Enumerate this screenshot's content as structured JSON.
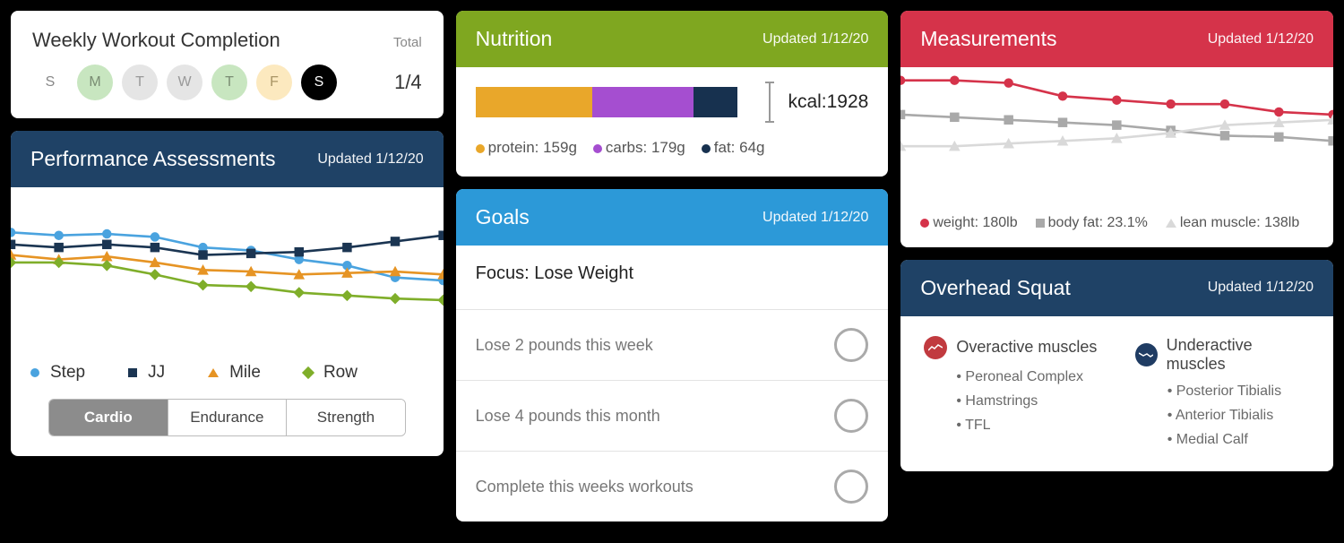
{
  "weekly": {
    "title": "Weekly Workout Completion",
    "total_label": "Total",
    "days": [
      "S",
      "M",
      "T",
      "W",
      "T",
      "F",
      "S"
    ],
    "day_styles": [
      "plain",
      "green",
      "grey",
      "grey",
      "green",
      "yellow",
      "black"
    ],
    "count": "1/4"
  },
  "performance": {
    "title": "Performance Assessments",
    "updated": "Updated 1/12/20",
    "legend": {
      "step": "Step",
      "jj": "JJ",
      "mile": "Mile",
      "row": "Row"
    },
    "tabs": [
      "Cardio",
      "Endurance",
      "Strength"
    ],
    "active_tab": 0,
    "colors": {
      "step": "#4aa3df",
      "jj": "#1b3552",
      "mile": "#e69424",
      "row": "#7fae2a"
    }
  },
  "nutrition": {
    "title": "Nutrition",
    "updated": "Updated 1/12/20",
    "kcal_label": "kcal:1928",
    "protein_label": "protein: 159g",
    "carbs_label": "carbs: 179g",
    "fat_label": "fat: 64g",
    "colors": {
      "protein": "#e9a72a",
      "carbs": "#a54ed0",
      "fat": "#17314f"
    },
    "segments_pct": {
      "protein": 40,
      "carbs": 35,
      "fat": 15
    }
  },
  "goals": {
    "title": "Goals",
    "updated": "Updated 1/12/20",
    "focus": "Focus: Lose Weight",
    "items": [
      "Lose 2 pounds this week",
      "Lose 4 pounds this month",
      "Complete this weeks workouts"
    ]
  },
  "measurements": {
    "title": "Measurements",
    "updated": "Updated 1/12/20",
    "weight_label": "weight: 180lb",
    "bodyfat_label": "body fat: 23.1%",
    "lean_label": "lean muscle: 138lb",
    "colors": {
      "weight": "#d5334a",
      "bodyfat": "#a9a9a9",
      "lean": "#d9d9d9"
    }
  },
  "squat": {
    "title": "Overhead Squat",
    "updated": "Updated 1/12/20",
    "overactive_title": "Overactive muscles",
    "underactive_title": "Underactive muscles",
    "overactive": [
      "Peroneal Complex",
      "Hamstrings",
      "TFL"
    ],
    "underactive": [
      "Posterior Tibialis",
      "Anterior Tibialis",
      "Medial Calf"
    ],
    "overactive_color": "#c13a3f",
    "underactive_color": "#1f3c63"
  },
  "chart_data": [
    {
      "type": "line",
      "title": "Performance Assessments",
      "x": [
        0,
        1,
        2,
        3,
        4,
        5,
        6,
        7,
        8,
        9
      ],
      "series": [
        {
          "name": "Step",
          "color": "#4aa3df",
          "values": [
            70,
            68,
            69,
            67,
            60,
            58,
            52,
            48,
            40,
            38
          ]
        },
        {
          "name": "JJ",
          "color": "#1b3552",
          "values": [
            62,
            60,
            62,
            60,
            55,
            56,
            57,
            60,
            64,
            68
          ]
        },
        {
          "name": "Mile",
          "color": "#e69424",
          "values": [
            55,
            52,
            54,
            50,
            45,
            44,
            42,
            43,
            44,
            42
          ]
        },
        {
          "name": "Row",
          "color": "#7fae2a",
          "values": [
            50,
            50,
            48,
            42,
            35,
            34,
            30,
            28,
            26,
            25
          ]
        }
      ],
      "ylim": [
        0,
        100
      ]
    },
    {
      "type": "bar",
      "title": "Nutrition",
      "categories": [
        "protein",
        "carbs",
        "fat"
      ],
      "values": [
        159,
        179,
        64
      ],
      "ylabel": "grams",
      "kcal": 1928
    },
    {
      "type": "line",
      "title": "Measurements",
      "x": [
        0,
        1,
        2,
        3,
        4,
        5,
        6,
        7,
        8
      ],
      "series": [
        {
          "name": "weight",
          "color": "#d5334a",
          "current": "180lb",
          "values": [
            90,
            90,
            88,
            78,
            75,
            72,
            72,
            66,
            64
          ]
        },
        {
          "name": "body fat",
          "color": "#a9a9a9",
          "current": "23.1%",
          "values": [
            64,
            62,
            60,
            58,
            56,
            52,
            48,
            47,
            44
          ]
        },
        {
          "name": "lean muscle",
          "color": "#d9d9d9",
          "current": "138lb",
          "values": [
            40,
            40,
            42,
            44,
            46,
            50,
            56,
            58,
            60
          ]
        }
      ],
      "ylim": [
        0,
        100
      ]
    }
  ]
}
